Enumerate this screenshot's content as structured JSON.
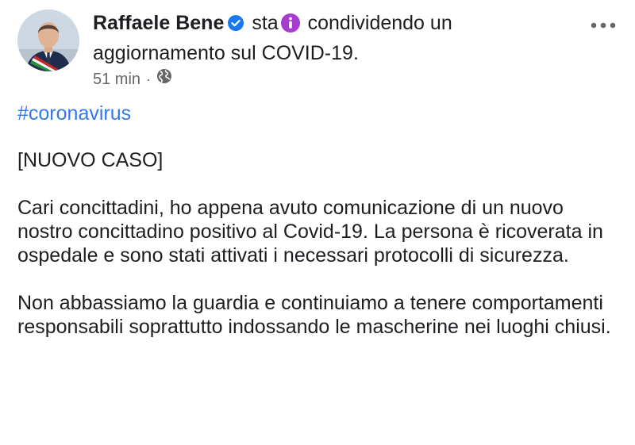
{
  "post": {
    "author": "Raffaele Bene",
    "activity_prefix": "sta",
    "activity_text": "condividendo un aggiornamento sul COVID-19.",
    "time": "51 min",
    "separator": "·",
    "hashtag": "#coronavirus",
    "paragraphs": [
      "[NUOVO CASO]",
      "Cari concittadini, ho appena avuto comunicazione di un nuovo nostro concittadino positivo al Covid-19. La persona è ricoverata in ospedale e sono stati attivati i necessari protocolli di sicurezza.",
      "Non abbassiamo la guardia e continuiamo a tenere comportamenti responsabili soprattutto indossando le mascherine nei luoghi chiusi."
    ]
  },
  "icons": {
    "verified": "verified-badge-icon",
    "activity": "info-icon",
    "privacy": "globe-icon",
    "more": "more-options-icon"
  },
  "colors": {
    "verified": "#1877f2",
    "activity": "#a53bd1",
    "hashtag": "#3578e5",
    "meta": "#65676b"
  }
}
